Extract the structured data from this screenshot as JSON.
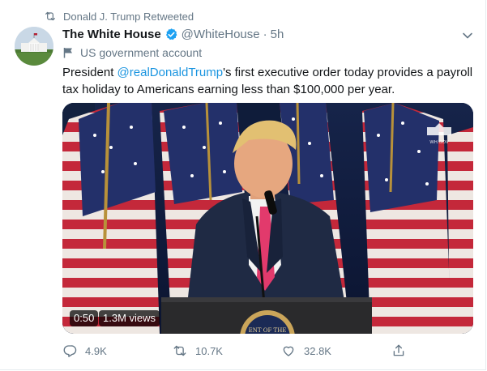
{
  "retweet": {
    "label": "Donald J. Trump Retweeted"
  },
  "author": {
    "name": "The White House",
    "handle": "@WhiteHouse",
    "separator": "·",
    "time": "5h",
    "label": "US government account"
  },
  "tweet": {
    "text_before": "President ",
    "mention": "@realDonaldTrump",
    "text_after": "'s first executive order today provides a payroll tax holiday to Americans earning less than $100,000 per year."
  },
  "media": {
    "duration": "0:50",
    "views": "1.3M views",
    "watermark": "WH.GOV",
    "podium_seal_text": "ENT OF THE"
  },
  "actions": {
    "replies": "4.9K",
    "retweets": "10.7K",
    "likes": "32.8K"
  },
  "colors": {
    "link": "#1b95e0",
    "muted": "#657786",
    "verified": "#1da1f2"
  }
}
